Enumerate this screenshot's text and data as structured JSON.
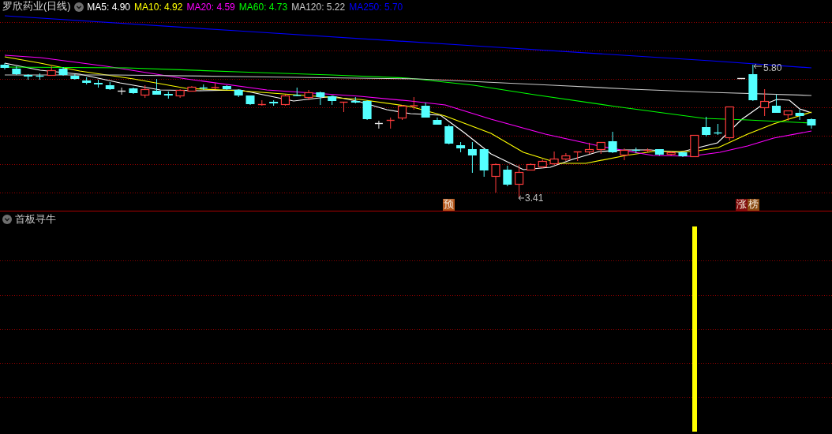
{
  "chart_header": {
    "title": "罗欣药业(日线)",
    "moving_averages": [
      {
        "label": "MA5: 4.90",
        "color": "#ffffff"
      },
      {
        "label": "MA10: 4.92",
        "color": "#ffff00"
      },
      {
        "label": "MA20: 4.59",
        "color": "#ff00ff"
      },
      {
        "label": "MA60: 4.73",
        "color": "#00ff00"
      },
      {
        "label": "MA120: 5.22",
        "color": "#c8c8c8"
      },
      {
        "label": "MA250: 5.70",
        "color": "#0000ff"
      }
    ]
  },
  "price_chart": {
    "high_label": "5.80",
    "low_label": "3.41",
    "signals": [
      {
        "text": "预",
        "color": "#b4571c"
      },
      {
        "text": "涨",
        "color": "#7f0c0c"
      },
      {
        "text": "榜",
        "color": "#8a4a12"
      }
    ]
  },
  "indicator_panel": {
    "title": "首板寻牛"
  }
}
